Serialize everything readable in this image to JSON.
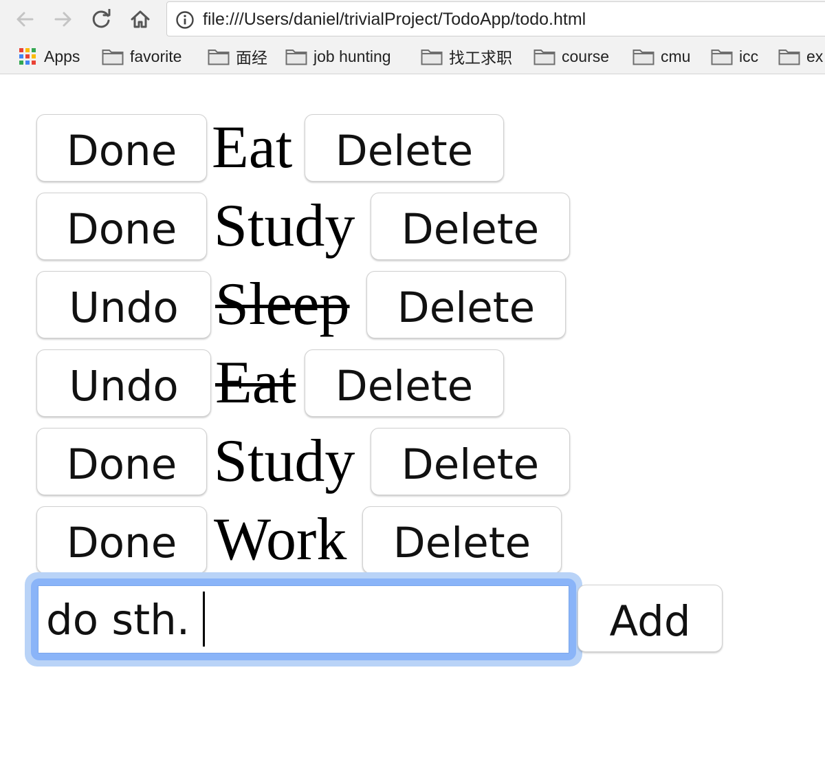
{
  "browser": {
    "url": "file:///Users/daniel/trivialProject/TodoApp/todo.html",
    "bookmarks": [
      {
        "label": "Apps",
        "icon": "apps-grid-icon"
      },
      {
        "label": "favorite",
        "icon": "folder-icon"
      },
      {
        "label": "面经",
        "icon": "folder-icon"
      },
      {
        "label": "job hunting",
        "icon": "folder-icon"
      },
      {
        "label": "找工求职",
        "icon": "folder-icon"
      },
      {
        "label": "course",
        "icon": "folder-icon"
      },
      {
        "label": "cmu",
        "icon": "folder-icon"
      },
      {
        "label": "icc",
        "icon": "folder-icon"
      },
      {
        "label": "ex",
        "icon": "folder-icon"
      }
    ]
  },
  "todos": [
    {
      "toggle_label": "Done",
      "text": "Eat",
      "completed": false,
      "delete_label": "Delete"
    },
    {
      "toggle_label": "Done",
      "text": "Study",
      "completed": false,
      "delete_label": "Delete"
    },
    {
      "toggle_label": "Undo",
      "text": "Sleep",
      "completed": true,
      "delete_label": "Delete"
    },
    {
      "toggle_label": "Undo",
      "text": "Eat",
      "completed": true,
      "delete_label": "Delete"
    },
    {
      "toggle_label": "Done",
      "text": "Study",
      "completed": false,
      "delete_label": "Delete"
    },
    {
      "toggle_label": "Done",
      "text": "Work",
      "completed": false,
      "delete_label": "Delete"
    }
  ],
  "new_todo": {
    "value": "do sth.",
    "add_label": "Add"
  },
  "colors": {
    "focus_ring": "#8ab4f8",
    "focus_glow": "#b9d3f7",
    "chrome_bg": "#f2f2f2"
  }
}
